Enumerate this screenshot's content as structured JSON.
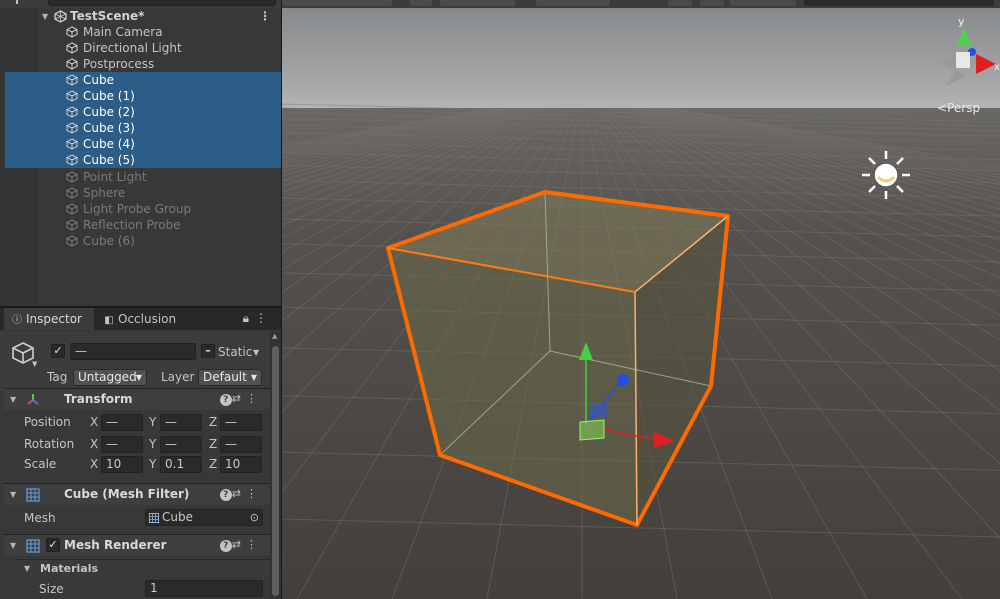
{
  "hierarchy": {
    "scene_name": "TestScene*",
    "items": [
      {
        "label": "Main Camera",
        "state": "normal"
      },
      {
        "label": "Directional Light",
        "state": "normal"
      },
      {
        "label": "Postprocess",
        "state": "normal"
      },
      {
        "label": "Cube",
        "state": "selected"
      },
      {
        "label": "Cube (1)",
        "state": "selected"
      },
      {
        "label": "Cube (2)",
        "state": "selected"
      },
      {
        "label": "Cube (3)",
        "state": "selected"
      },
      {
        "label": "Cube (4)",
        "state": "selected"
      },
      {
        "label": "Cube (5)",
        "state": "selected"
      },
      {
        "label": "Point Light",
        "state": "inactive"
      },
      {
        "label": "Sphere",
        "state": "inactive"
      },
      {
        "label": "Light Probe Group",
        "state": "inactive"
      },
      {
        "label": "Reflection Probe",
        "state": "inactive"
      },
      {
        "label": "Cube (6)",
        "state": "inactive"
      }
    ]
  },
  "inspector": {
    "tabs": [
      {
        "label": "Inspector",
        "icon": "info-icon"
      },
      {
        "label": "Occlusion",
        "icon": "occlusion-icon"
      }
    ],
    "object": {
      "active": true,
      "name": "—",
      "static_label": "Static",
      "tag_label": "Tag",
      "tag_value": "Untagged",
      "layer_label": "Layer",
      "layer_value": "Default"
    },
    "transform": {
      "title": "Transform",
      "position_label": "Position",
      "rotation_label": "Rotation",
      "scale_label": "Scale",
      "axis_x": "X",
      "axis_y": "Y",
      "axis_z": "Z",
      "position": {
        "x": "—",
        "y": "—",
        "z": "—"
      },
      "rotation": {
        "x": "—",
        "y": "—",
        "z": "—"
      },
      "scale": {
        "x": "10",
        "y": "0.1",
        "z": "10"
      }
    },
    "mesh_filter": {
      "title": "Cube (Mesh Filter)",
      "mesh_label": "Mesh",
      "mesh_value": "Cube"
    },
    "mesh_renderer": {
      "title": "Mesh Renderer",
      "enabled": true,
      "materials_label": "Materials",
      "size_label": "Size",
      "size_value": "1"
    }
  },
  "scene": {
    "persp_label": "Persp",
    "gizmo_y_label": "y",
    "gizmo_x_label": "x",
    "selection_color": "#ff6a00",
    "colors": {
      "x_axis": "#e02020",
      "y_axis": "#40d040",
      "z_axis": "#2050e0"
    }
  }
}
